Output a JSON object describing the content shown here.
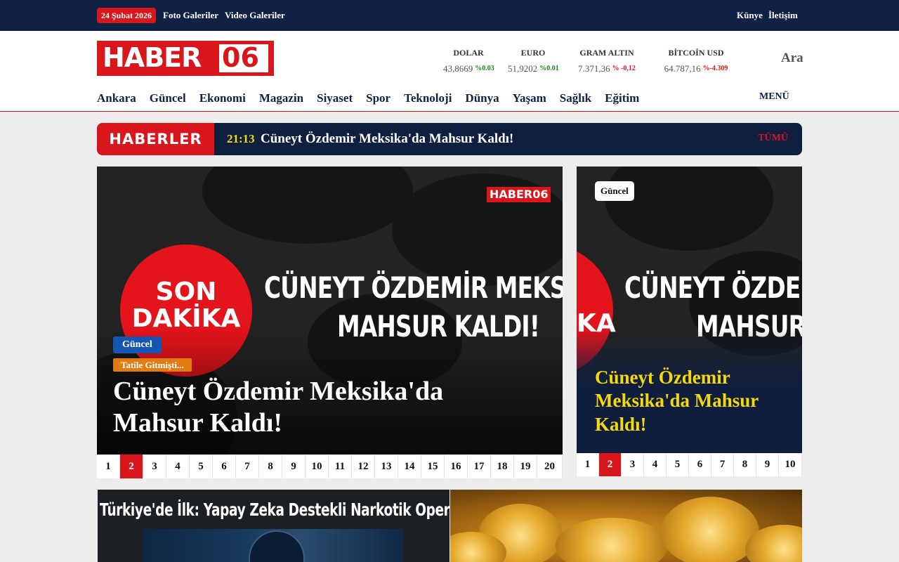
{
  "topbar": {
    "date": "24 Şubat 2026",
    "links": [
      "Foto Galeriler",
      "Video Galeriler"
    ],
    "right_links": [
      "Künye",
      "İletişim"
    ]
  },
  "header": {
    "logo_left": "HABER",
    "logo_right": "06",
    "search_label": "Ara",
    "menu_label": "MENÜ",
    "tickers": [
      {
        "name": "DOLAR",
        "value": "43,8669",
        "change": "%0.03",
        "color": "#1a7f1a"
      },
      {
        "name": "EURO",
        "value": "51,9202",
        "change": "%0.01",
        "color": "#1a7f1a"
      },
      {
        "name": "GRAM ALTIN",
        "value": "7.371,36",
        "change": "% -0,12",
        "color": "#d9161c"
      },
      {
        "name": "BİTCOİN USD",
        "value": "64.787,16",
        "change": "%-4.309",
        "color": "#d9161c"
      }
    ],
    "nav": [
      "Ankara",
      "Güncel",
      "Ekonomi",
      "Magazin",
      "Siyaset",
      "Spor",
      "Teknoloji",
      "Dünya",
      "Yaşam",
      "Sağlık",
      "Eğitim"
    ]
  },
  "breaking": {
    "label": "HABERLER",
    "time": "21:13",
    "text": "Cüneyt Özdemir Meksika'da Mahsur Kaldı!",
    "all_label": "TÜMÜ"
  },
  "main_slider": {
    "image_badge": "SON DAKİKA",
    "image_badge_line1": "SON",
    "image_badge_line2": "DAKİKA",
    "image_headline_line1": "CÜNEYT ÖZDEMİR MEKSİKA’DA",
    "image_headline_line2": "MAHSUR KALDI!",
    "watermark": "HABER06",
    "category": "Güncel",
    "tag": "Tatile Gitmişti...",
    "title": "Cüneyt Özdemir Meksika'da Mahsur Kaldı!",
    "pages": [
      "1",
      "2",
      "3",
      "4",
      "5",
      "6",
      "7",
      "8",
      "9",
      "10",
      "11",
      "12",
      "13",
      "14",
      "15",
      "16",
      "17",
      "18",
      "19",
      "20"
    ],
    "active_page": "2"
  },
  "side_slider": {
    "category": "Güncel",
    "image_headline_line1": "CÜNEYT ÖZDEMİR MEKSİKA’DA",
    "image_headline_line2": "MAHSUR KALDI!",
    "image_badge_part": "KA",
    "title": "Cüneyt Özdemir Meksika'da Mahsur Kaldı!",
    "pages": [
      "1",
      "2",
      "3",
      "4",
      "5",
      "6",
      "7",
      "8",
      "9",
      "10"
    ],
    "active_page": "2"
  },
  "cards": [
    {
      "image_text": "Türkiye'de İlk: Yapay Zeka Destekli Narkotik Operasyonu!"
    }
  ]
}
